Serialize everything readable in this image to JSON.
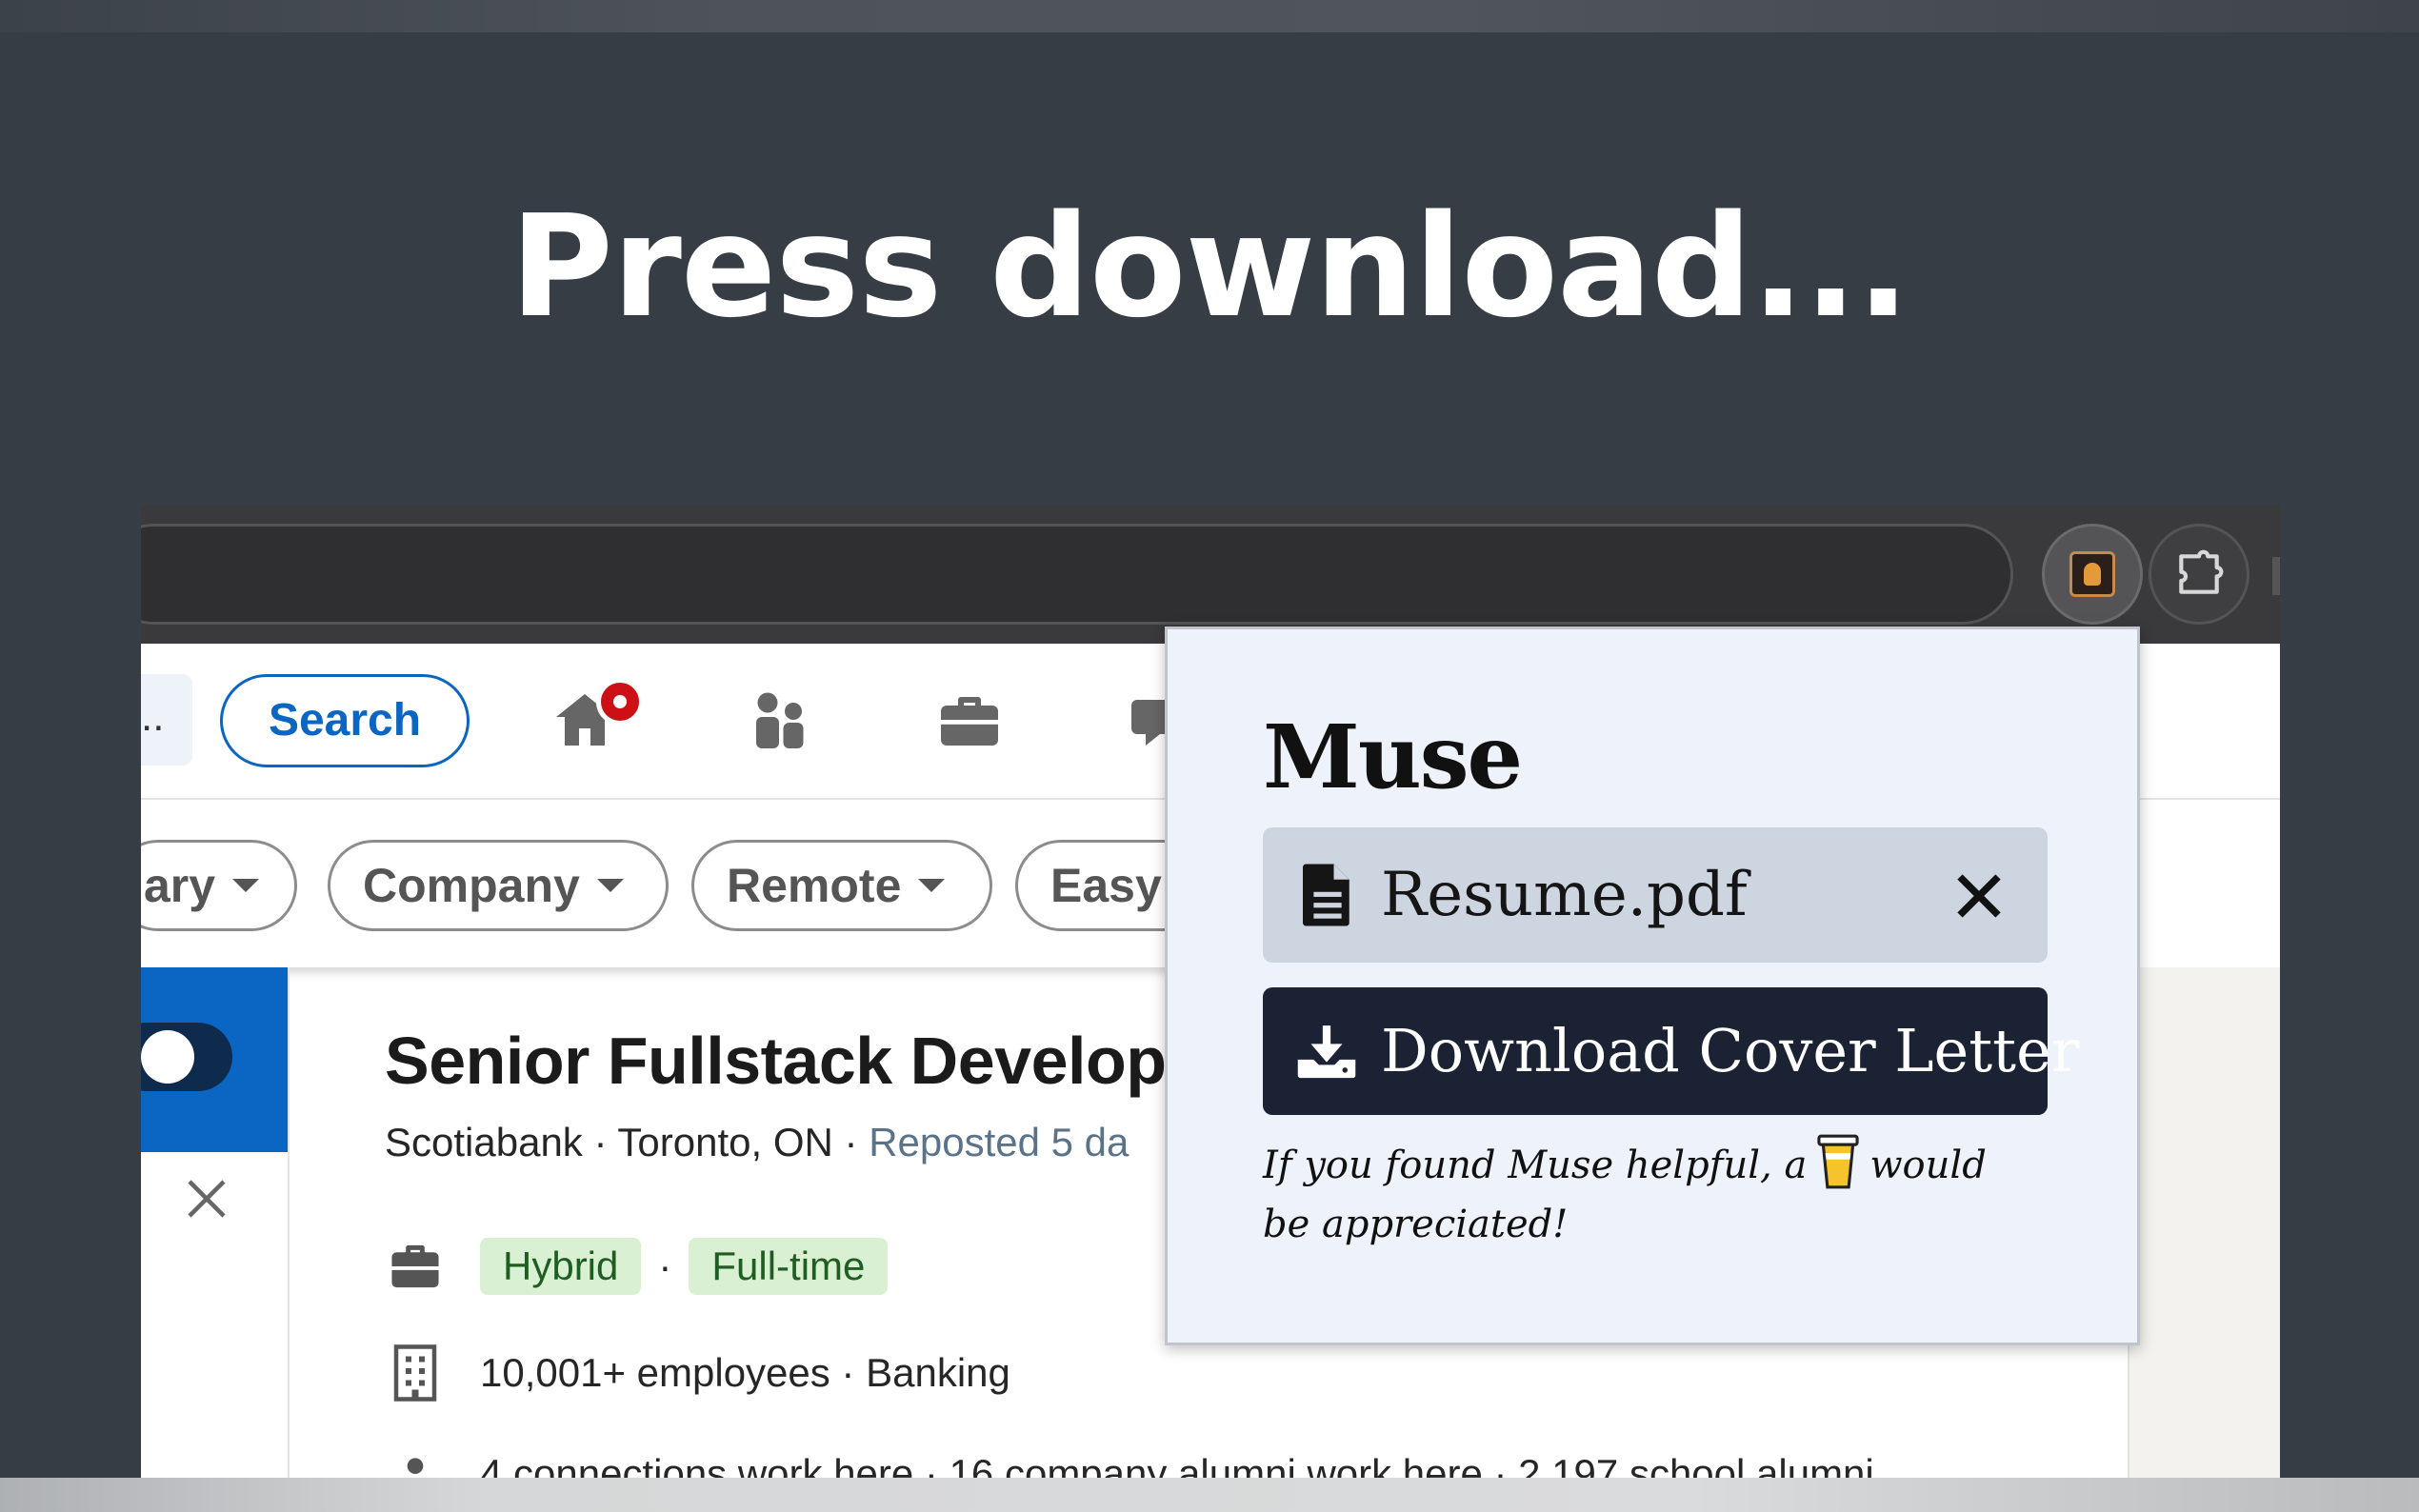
{
  "headline": "Press download...",
  "browser": {
    "extensions": [
      {
        "name": "Muse",
        "icon": "muse-icon"
      },
      {
        "name": "Extensions",
        "icon": "puzzle-icon"
      }
    ]
  },
  "linkedin": {
    "search_stub": "..",
    "search_button": "Search",
    "nav_icons": [
      "home-icon",
      "my-network-icon",
      "jobs-icon",
      "messaging-icon"
    ],
    "filters": [
      "ary",
      "Company",
      "Remote",
      "Easy"
    ],
    "job": {
      "title": "Senior Fullstack Develop",
      "company": "Scotiabank",
      "location": "Toronto, ON",
      "reposted": "Reposted 5 da",
      "separator": "·",
      "tags": [
        "Hybrid",
        "Full-time"
      ],
      "company_info": "10,001+ employees · Banking",
      "connections": "4 connections work here · 16 company alumni work here · 2,197 school alumni"
    }
  },
  "popup": {
    "title": "Muse",
    "file_name": "Resume.pdf",
    "download_label": "Download Cover Letter",
    "support_before": "If you found Muse helpful, a",
    "support_after": "would be appreciated!"
  },
  "colors": {
    "background": "#373d44",
    "linkedin_blue": "#0a66c2",
    "popup_bg": "#eef2fa",
    "download_bg": "#1a2234",
    "tag_bg": "#daf0d3",
    "badge_red": "#cc1016"
  }
}
